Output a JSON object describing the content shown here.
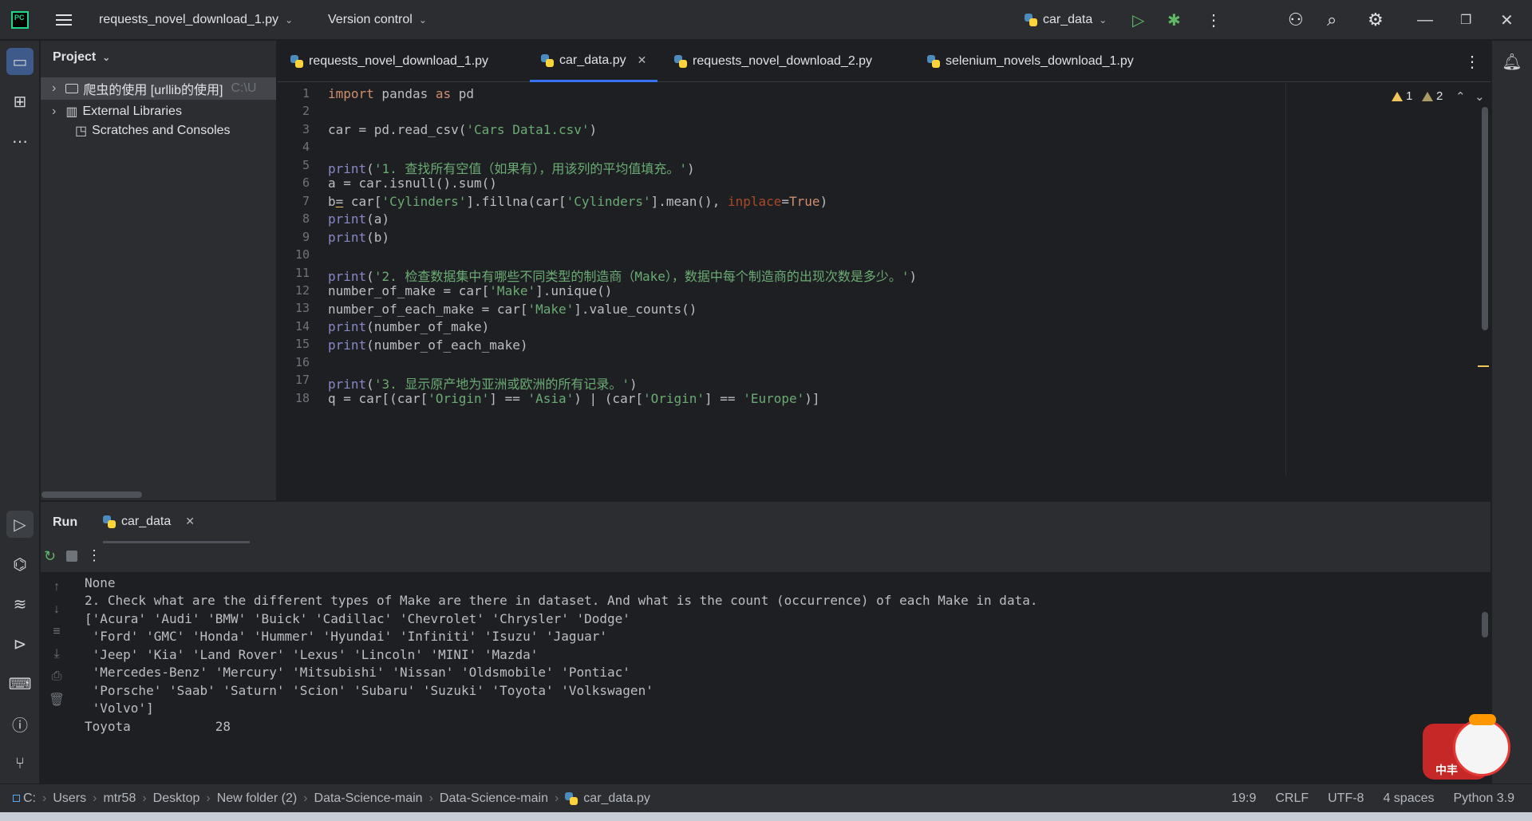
{
  "titlebar": {
    "project_file": "requests_novel_download_1.py",
    "vcs": "Version control",
    "run_config": "car_data"
  },
  "project_panel": {
    "title": "Project",
    "items": [
      {
        "label": "爬虫的使用 [urllib的使用]",
        "hint": "C:\\U"
      },
      {
        "label": "External Libraries"
      },
      {
        "label": "Scratches and Consoles"
      }
    ]
  },
  "tabs": [
    {
      "label": "requests_novel_download_1.py"
    },
    {
      "label": "car_data.py"
    },
    {
      "label": "requests_novel_download_2.py"
    },
    {
      "label": "selenium_novels_download_1.py"
    }
  ],
  "editor": {
    "warnings_a": "1",
    "warnings_b": "2",
    "line_numbers": [
      "1",
      "2",
      "3",
      "4",
      "5",
      "6",
      "7",
      "8",
      "9",
      "10",
      "11",
      "12",
      "13",
      "14",
      "15",
      "16",
      "17",
      "18"
    ]
  },
  "run": {
    "title": "Run",
    "tab": "car_data",
    "console": [
      "None",
      "2. Check what are the different types of Make are there in dataset. And what is the count (occurrence) of each Make in data.",
      "['Acura' 'Audi' 'BMW' 'Buick' 'Cadillac' 'Chevrolet' 'Chrysler' 'Dodge'",
      " 'Ford' 'GMC' 'Honda' 'Hummer' 'Hyundai' 'Infiniti' 'Isuzu' 'Jaguar'",
      " 'Jeep' 'Kia' 'Land Rover' 'Lexus' 'Lincoln' 'MINI' 'Mazda'",
      " 'Mercedes-Benz' 'Mercury' 'Mitsubishi' 'Nissan' 'Oldsmobile' 'Pontiac'",
      " 'Porsche' 'Saab' 'Saturn' 'Scion' 'Subaru' 'Suzuki' 'Toyota' 'Volkswagen'",
      " 'Volvo']",
      "Toyota           28"
    ]
  },
  "statusbar": {
    "breadcrumbs": [
      "C:",
      "Users",
      "mtr58",
      "Desktop",
      "New folder (2)",
      "Data-Science-main",
      "Data-Science-main",
      "car_data.py"
    ],
    "position": "19:9",
    "line_sep": "CRLF",
    "encoding": "UTF-8",
    "indent": "4 spaces",
    "interpreter": "Python 3.9"
  },
  "mascot": {
    "text": "中丰"
  }
}
